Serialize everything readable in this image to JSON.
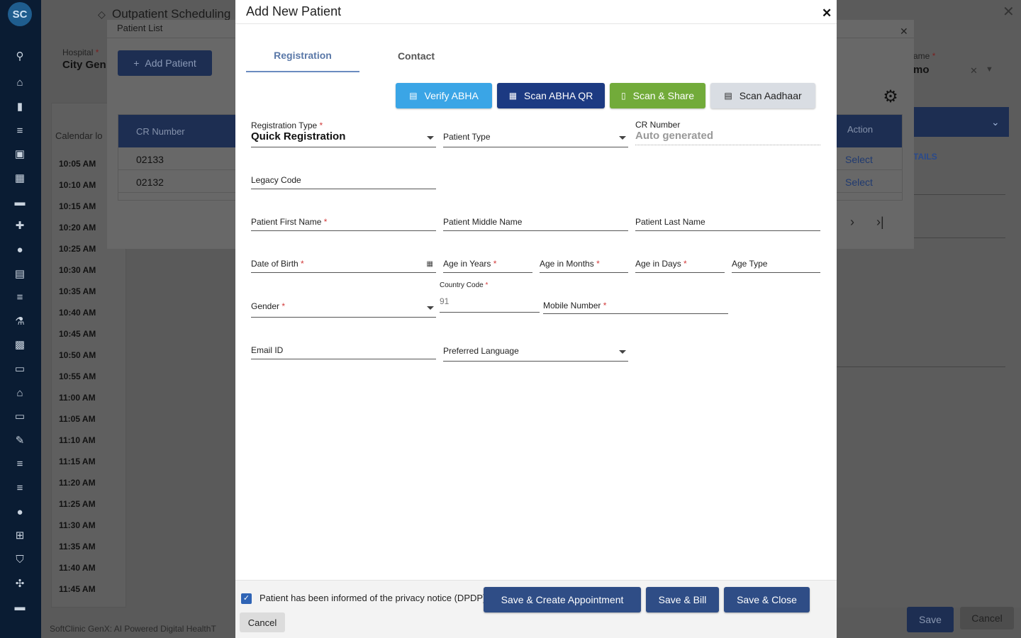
{
  "app": {
    "logo_text": "SC",
    "title": "Outpatient Scheduling",
    "footer": "SoftClinic GenX: AI Powered Digital HealthT",
    "close_glyph": "✕"
  },
  "sidebar_icons": [
    "search-icon",
    "home-icon",
    "chart-icon",
    "list-icon",
    "bag-icon",
    "calendar-icon",
    "bed-icon",
    "medical-plus-icon",
    "user-icon",
    "document-icon",
    "menu-icon",
    "lab-icon",
    "medicine-icon",
    "book-icon",
    "building-icon",
    "devices-icon",
    "tools-icon",
    "menu-icon-2",
    "menu-icon-3",
    "drop-icon",
    "add-box-icon",
    "shield-icon",
    "settings-network-icon",
    "folder-icon"
  ],
  "calendar": {
    "label": "Calendar lo",
    "slots": [
      "10:05 AM",
      "10:10 AM",
      "10:15 AM",
      "10:20 AM",
      "10:25 AM",
      "10:30 AM",
      "10:35 AM",
      "10:40 AM",
      "10:45 AM",
      "10:50 AM",
      "10:55 AM",
      "11:00 AM",
      "11:05 AM",
      "11:10 AM",
      "11:15 AM",
      "11:20 AM",
      "11:25 AM",
      "11:30 AM",
      "11:35 AM",
      "11:40 AM",
      "11:45 AM"
    ]
  },
  "right_panel": {
    "label": "ame",
    "required_mark": "*",
    "value": "mo",
    "details_text": "TAILS",
    "save_label": "Save",
    "cancel_label": "Cancel"
  },
  "patient_list": {
    "title": "Patient List",
    "hospital_label": "Hospital",
    "hospital_value": "City Gen",
    "add_patient_label": "Add Patient",
    "columns": {
      "cr": "CR Number",
      "action": "Action"
    },
    "rows": [
      {
        "cr": "02133",
        "action": "Select"
      },
      {
        "cr": "02132",
        "action": "Select"
      }
    ]
  },
  "modal": {
    "title": "Add New Patient",
    "tabs": {
      "registration": "Registration",
      "contact": "Contact"
    },
    "buttons": {
      "verify_abha": "Verify ABHA",
      "scan_abha_qr": "Scan ABHA QR",
      "scan_share": "Scan & Share",
      "scan_aadhaar": "Scan Aadhaar"
    },
    "fields": {
      "registration_type": {
        "label": "Registration Type",
        "value": "Quick Registration"
      },
      "patient_type": {
        "label": "Patient Type"
      },
      "cr_number": {
        "label": "CR Number",
        "value": "Auto generated"
      },
      "legacy_code": {
        "label": "Legacy Code"
      },
      "first_name": {
        "label": "Patient First Name"
      },
      "middle_name": {
        "label": "Patient Middle Name"
      },
      "last_name": {
        "label": "Patient Last Name"
      },
      "dob": {
        "label": "Date of Birth"
      },
      "age_years": {
        "label": "Age in Years"
      },
      "age_months": {
        "label": "Age in Months"
      },
      "age_days": {
        "label": "Age in Days"
      },
      "age_type": {
        "label": "Age Type"
      },
      "gender": {
        "label": "Gender"
      },
      "country_code": {
        "label": "Country Code",
        "value": "91"
      },
      "mobile": {
        "label": "Mobile Number"
      },
      "email": {
        "label": "Email ID"
      },
      "preferred_language": {
        "label": "Preferred Language"
      }
    },
    "required_mark": "*",
    "footer": {
      "privacy_notice": "Patient has been informed of the privacy notice (DPDP)",
      "privacy_checked": true,
      "save_create_appointment": "Save & Create Appointment",
      "save_bill": "Save & Bill",
      "save_close": "Save & Close",
      "cancel": "Cancel"
    }
  }
}
